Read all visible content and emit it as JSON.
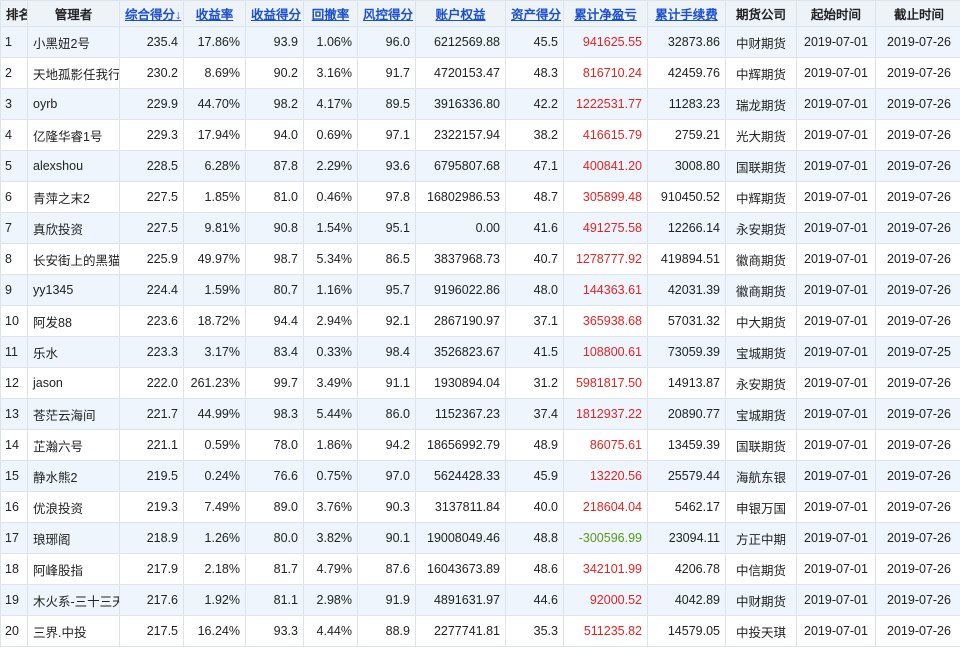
{
  "headers": [
    {
      "label": "排名",
      "sortable": false
    },
    {
      "label": "管理者",
      "sortable": false
    },
    {
      "label": "综合得分↓",
      "sortable": true
    },
    {
      "label": "收益率",
      "sortable": true
    },
    {
      "label": "收益得分",
      "sortable": true
    },
    {
      "label": "回撤率",
      "sortable": true
    },
    {
      "label": "风控得分",
      "sortable": true
    },
    {
      "label": "账户权益",
      "sortable": true
    },
    {
      "label": "资产得分",
      "sortable": true
    },
    {
      "label": "累计净盈亏",
      "sortable": true
    },
    {
      "label": "累计手续费",
      "sortable": true
    },
    {
      "label": "期货公司",
      "sortable": false
    },
    {
      "label": "起始时间",
      "sortable": false
    },
    {
      "label": "截止时间",
      "sortable": false
    }
  ],
  "rows": [
    [
      "1",
      "小黑妞2号",
      "235.4",
      "17.86%",
      "93.9",
      "1.06%",
      "96.0",
      "6212569.88",
      "45.5",
      "941625.55",
      "32873.86",
      "中财期货",
      "2019-07-01",
      "2019-07-26"
    ],
    [
      "2",
      "天地孤影任我行",
      "230.2",
      "8.69%",
      "90.2",
      "3.16%",
      "91.7",
      "4720153.47",
      "48.3",
      "816710.24",
      "42459.76",
      "中辉期货",
      "2019-07-01",
      "2019-07-26"
    ],
    [
      "3",
      "oyrb",
      "229.9",
      "44.70%",
      "98.2",
      "4.17%",
      "89.5",
      "3916336.80",
      "42.2",
      "1222531.77",
      "11283.23",
      "瑞龙期货",
      "2019-07-01",
      "2019-07-26"
    ],
    [
      "4",
      "亿隆华睿1号",
      "229.3",
      "17.94%",
      "94.0",
      "0.69%",
      "97.1",
      "2322157.94",
      "38.2",
      "416615.79",
      "2759.21",
      "光大期货",
      "2019-07-01",
      "2019-07-26"
    ],
    [
      "5",
      "alexshou",
      "228.5",
      "6.28%",
      "87.8",
      "2.29%",
      "93.6",
      "6795807.68",
      "47.1",
      "400841.20",
      "3008.80",
      "国联期货",
      "2019-07-01",
      "2019-07-26"
    ],
    [
      "6",
      "青萍之末2",
      "227.5",
      "1.85%",
      "81.0",
      "0.46%",
      "97.8",
      "16802986.53",
      "48.7",
      "305899.48",
      "910450.52",
      "中辉期货",
      "2019-07-01",
      "2019-07-26"
    ],
    [
      "7",
      "真欣投资",
      "227.5",
      "9.81%",
      "90.8",
      "1.54%",
      "95.1",
      "0.00",
      "41.6",
      "491275.58",
      "12266.14",
      "永安期货",
      "2019-07-01",
      "2019-07-26"
    ],
    [
      "8",
      "长安街上的黑猫",
      "225.9",
      "49.97%",
      "98.7",
      "5.34%",
      "86.5",
      "3837968.73",
      "40.7",
      "1278777.92",
      "419894.51",
      "徽商期货",
      "2019-07-01",
      "2019-07-26"
    ],
    [
      "9",
      "yy1345",
      "224.4",
      "1.59%",
      "80.7",
      "1.16%",
      "95.7",
      "9196022.86",
      "48.0",
      "144363.61",
      "42031.39",
      "徽商期货",
      "2019-07-01",
      "2019-07-26"
    ],
    [
      "10",
      "阿发88",
      "223.6",
      "18.72%",
      "94.4",
      "2.94%",
      "92.1",
      "2867190.97",
      "37.1",
      "365938.68",
      "57031.32",
      "中大期货",
      "2019-07-01",
      "2019-07-26"
    ],
    [
      "11",
      "乐水",
      "223.3",
      "3.17%",
      "83.4",
      "0.33%",
      "98.4",
      "3526823.67",
      "41.5",
      "108800.61",
      "73059.39",
      "宝城期货",
      "2019-07-01",
      "2019-07-25"
    ],
    [
      "12",
      "jason",
      "222.0",
      "261.23%",
      "99.7",
      "3.49%",
      "91.1",
      "1930894.04",
      "31.2",
      "5981817.50",
      "14913.87",
      "永安期货",
      "2019-07-01",
      "2019-07-26"
    ],
    [
      "13",
      "苍茫云海间",
      "221.7",
      "44.99%",
      "98.3",
      "5.44%",
      "86.0",
      "1152367.23",
      "37.4",
      "1812937.22",
      "20890.77",
      "宝城期货",
      "2019-07-01",
      "2019-07-26"
    ],
    [
      "14",
      "芷瀚六号",
      "221.1",
      "0.59%",
      "78.0",
      "1.86%",
      "94.2",
      "18656992.79",
      "48.9",
      "86075.61",
      "13459.39",
      "国联期货",
      "2019-07-01",
      "2019-07-26"
    ],
    [
      "15",
      "静水熊2",
      "219.5",
      "0.24%",
      "76.6",
      "0.75%",
      "97.0",
      "5624428.33",
      "45.9",
      "13220.56",
      "25579.44",
      "海航东银",
      "2019-07-01",
      "2019-07-26"
    ],
    [
      "16",
      "优浪投资",
      "219.3",
      "7.49%",
      "89.0",
      "3.76%",
      "90.3",
      "3137811.84",
      "40.0",
      "218604.04",
      "5462.17",
      "申银万国",
      "2019-07-01",
      "2019-07-26"
    ],
    [
      "17",
      "琅琊阁",
      "218.9",
      "1.26%",
      "80.0",
      "3.82%",
      "90.1",
      "19008049.46",
      "48.8",
      "-300596.99",
      "23094.11",
      "方正中期",
      "2019-07-01",
      "2019-07-26"
    ],
    [
      "18",
      "阿峰股指",
      "217.9",
      "2.18%",
      "81.7",
      "4.79%",
      "87.6",
      "16043673.89",
      "48.6",
      "342101.99",
      "4206.78",
      "中信期货",
      "2019-07-01",
      "2019-07-26"
    ],
    [
      "19",
      "木火系-三十三天",
      "217.6",
      "1.92%",
      "81.1",
      "2.98%",
      "91.9",
      "4891631.97",
      "44.6",
      "92000.52",
      "4042.89",
      "中财期货",
      "2019-07-01",
      "2019-07-26"
    ],
    [
      "20",
      "三界.中投",
      "217.5",
      "16.24%",
      "93.3",
      "4.44%",
      "88.9",
      "2277741.81",
      "35.3",
      "511235.82",
      "14579.05",
      "中投天琪",
      "2019-07-01",
      "2019-07-26"
    ]
  ],
  "colors": {
    "positive_pnl": "#e02424",
    "negative_pnl": "#5a9a1a",
    "header_link": "#1a4fd0"
  }
}
